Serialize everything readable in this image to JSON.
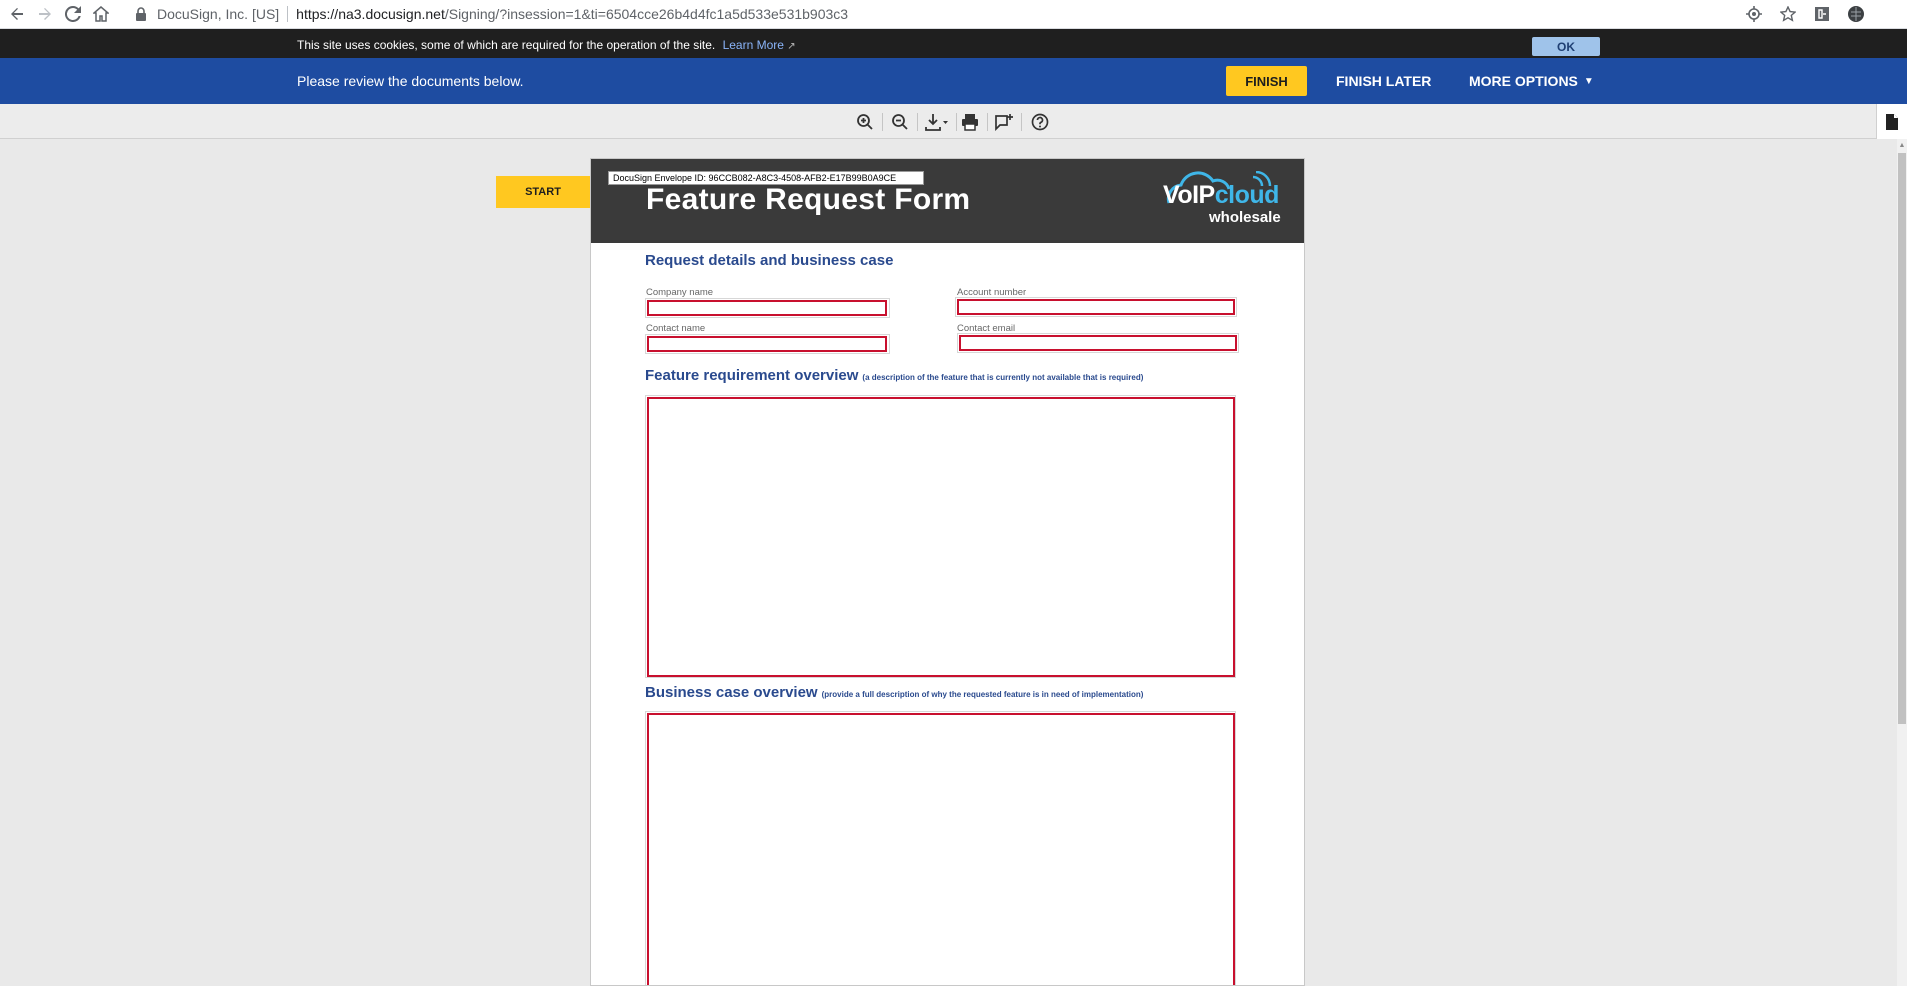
{
  "browser": {
    "site_name": "DocuSign, Inc. [US]",
    "url_main": "https://na3.docusign.net",
    "url_rest": "/Signing/?insession=1&ti=6504cce26b4d4fc1a5d533e531b903c3"
  },
  "cookie_bar": {
    "text": "This site uses cookies, some of which are required for the operation of the site.",
    "link": "Learn More",
    "ok_label": "OK"
  },
  "header": {
    "message": "Please review the documents below.",
    "finish_label": "FINISH",
    "finish_later_label": "FINISH LATER",
    "more_options_label": "MORE OPTIONS",
    "accent_color": "#ffc820",
    "bar_color": "#1e4ca1"
  },
  "toolbar": {
    "tools": [
      "zoom-in-icon",
      "zoom-out-icon",
      "download-icon",
      "print-icon",
      "comment-add-icon",
      "help-icon"
    ]
  },
  "viewer": {
    "start_label": "START"
  },
  "document": {
    "envelope_id": "DocuSign Envelope ID: 96CCB082-A8C3-4508-AFB2-E17B99B0A9CE",
    "title": "Feature Request Form",
    "logo_voip": "VoIP",
    "logo_cloud": "cloud",
    "logo_wholesale": "wholesale",
    "section1_title": "Request details and business case",
    "company_label": "Company name",
    "account_label": "Account number",
    "contact_name_label": "Contact name",
    "contact_email_label": "Contact email",
    "section2_title": "Feature requirement overview",
    "section2_note": "(a description of the feature that is currently not available that is required)",
    "section3_title": "Business case overview",
    "section3_note": "(provide a full description of why the requested feature is in need of implementation)",
    "field_border_color": "#c8102e"
  }
}
